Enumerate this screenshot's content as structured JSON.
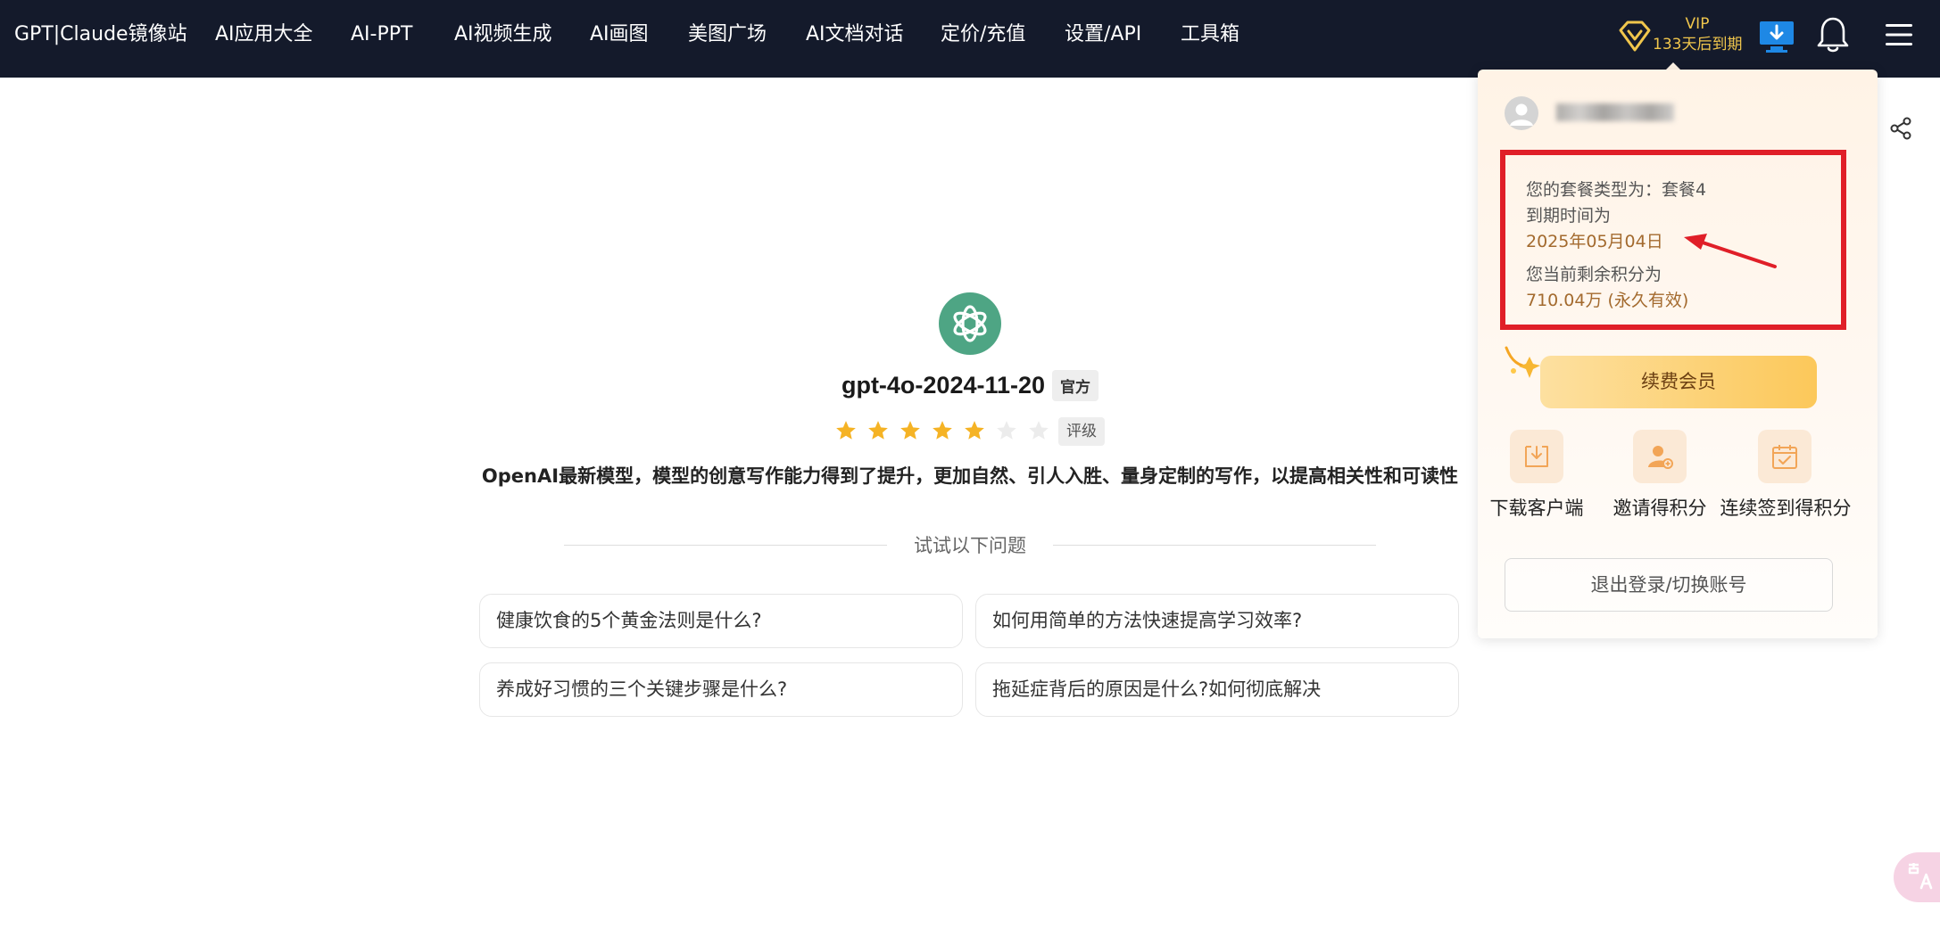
{
  "nav": {
    "items": [
      {
        "label": "GPT|Claude镜像站"
      },
      {
        "label": "AI应用大全"
      },
      {
        "label": "AI-PPT"
      },
      {
        "label": "AI视频生成"
      },
      {
        "label": "AI画图"
      },
      {
        "label": "美图广场"
      },
      {
        "label": "AI文档对话"
      },
      {
        "label": "定价/充值"
      },
      {
        "label": "设置/API"
      },
      {
        "label": "工具箱"
      }
    ],
    "vip": {
      "label": "VIP",
      "status": "133天后到期",
      "color": "#f0c64c"
    },
    "icons": [
      "vip-diamond-icon",
      "download-client-icon",
      "bell-icon",
      "hamburger-menu-icon"
    ]
  },
  "main": {
    "model_name": "gpt-4o-2024-11-20",
    "model_tag": "官方",
    "rating": {
      "stars_filled": 5,
      "stars_total": 7,
      "label": "评级"
    },
    "description": "OpenAI最新模型，模型的创意写作能力得到了提升，更加自然、引人入胜、量身定制的写作，以提高相关性和可读性",
    "try_label": "试试以下问题",
    "questions": [
      {
        "text": "健康饮食的5个黄金法则是什么?"
      },
      {
        "text": "如何用简单的方法快速提高学习效率?"
      },
      {
        "text": "养成好习惯的三个关键步骤是什么?"
      },
      {
        "text": "拖延症背后的原因是什么?如何彻底解决"
      }
    ]
  },
  "panel": {
    "plan_type_line": "您的套餐类型为：套餐4",
    "expire_label": "到期时间为",
    "expire_date": "2025年05月04日",
    "points_label": "您当前剩余积分为",
    "points_value": "710.04万 (永久有效)",
    "renew_button": "续费会员",
    "features": [
      {
        "label": "下载客户端",
        "icon": "download-tray-icon"
      },
      {
        "label": "邀请得积分",
        "icon": "invite-user-icon"
      },
      {
        "label": "连续签到得积分",
        "icon": "calendar-check-icon"
      }
    ],
    "logout_button": "退出登录/切换账号",
    "highlight_color": "#e01f28",
    "accent_color": "#a36a2e"
  }
}
